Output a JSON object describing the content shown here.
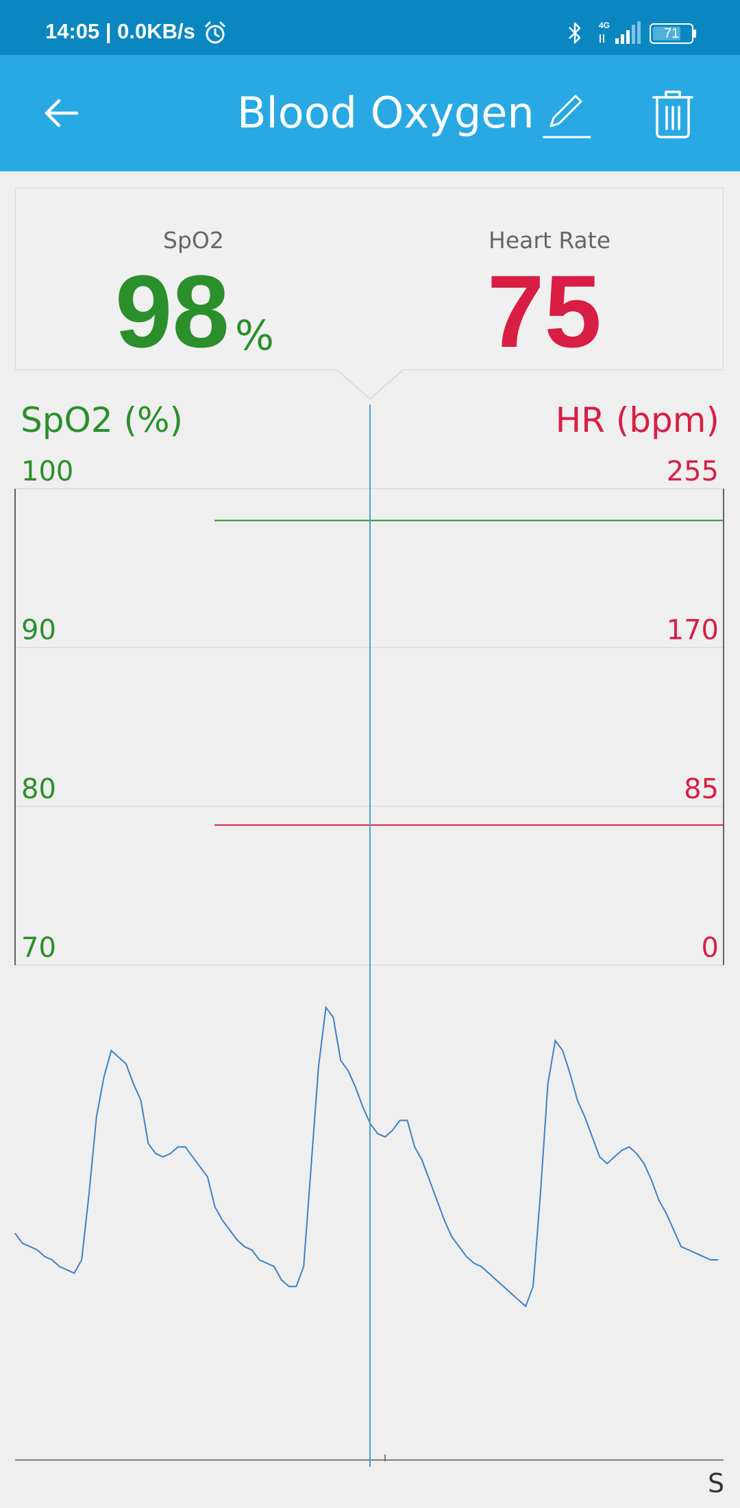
{
  "status_bar": {
    "time_speed": "14:05 | 0.0KB/s",
    "network": "4G",
    "battery_level": "71",
    "icons": [
      "alarm-icon",
      "bluetooth-icon",
      "signal-icon",
      "battery-icon"
    ]
  },
  "app_bar": {
    "title": "Blood Oxygen",
    "icons": [
      "back-arrow-icon",
      "edit-icon",
      "delete-icon"
    ]
  },
  "readout": {
    "spo2_label": "SpO2",
    "spo2_value": "98",
    "spo2_unit": "%",
    "hr_label": "Heart Rate",
    "hr_value": "75"
  },
  "colors": {
    "header": "#29a9e3",
    "status_bar": "#0a87c0",
    "spo2": "#2b8f2b",
    "heart_rate": "#d81e45",
    "cursor": "#4a9fd5",
    "waveform": "#3f7fc1"
  },
  "chart_data": {
    "type": "line",
    "left_axis": {
      "label": "SpO2 (%)",
      "ticks": [
        "100",
        "90",
        "80",
        "70"
      ],
      "range": [
        70,
        100
      ]
    },
    "right_axis": {
      "label": "HR (bpm)",
      "ticks": [
        "255",
        "170",
        "85",
        "0"
      ],
      "range": [
        0,
        255
      ]
    },
    "series": [
      {
        "axis": "left",
        "value": 98
      },
      {
        "axis": "right",
        "value": 75
      }
    ],
    "grid": true,
    "waveform_axis_unit": "S",
    "waveform": [
      0.6,
      0.57,
      0.56,
      0.55,
      0.53,
      0.52,
      0.5,
      0.49,
      0.48,
      0.52,
      0.72,
      0.95,
      1.07,
      1.15,
      1.13,
      1.11,
      1.05,
      1.0,
      0.87,
      0.84,
      0.83,
      0.84,
      0.86,
      0.86,
      0.83,
      0.8,
      0.77,
      0.68,
      0.64,
      0.61,
      0.58,
      0.56,
      0.55,
      0.52,
      0.51,
      0.5,
      0.46,
      0.44,
      0.44,
      0.5,
      0.8,
      1.1,
      1.28,
      1.25,
      1.12,
      1.09,
      1.04,
      0.98,
      0.93,
      0.9,
      0.89,
      0.91,
      0.94,
      0.94,
      0.86,
      0.82,
      0.76,
      0.7,
      0.64,
      0.59,
      0.56,
      0.53,
      0.51,
      0.5,
      0.48,
      0.46,
      0.44,
      0.42,
      0.4,
      0.38,
      0.44,
      0.72,
      1.05,
      1.18,
      1.15,
      1.08,
      1.0,
      0.95,
      0.89,
      0.83,
      0.81,
      0.83,
      0.85,
      0.86,
      0.84,
      0.81,
      0.76,
      0.7,
      0.66,
      0.61,
      0.56,
      0.55,
      0.54,
      0.53,
      0.52,
      0.52
    ]
  }
}
